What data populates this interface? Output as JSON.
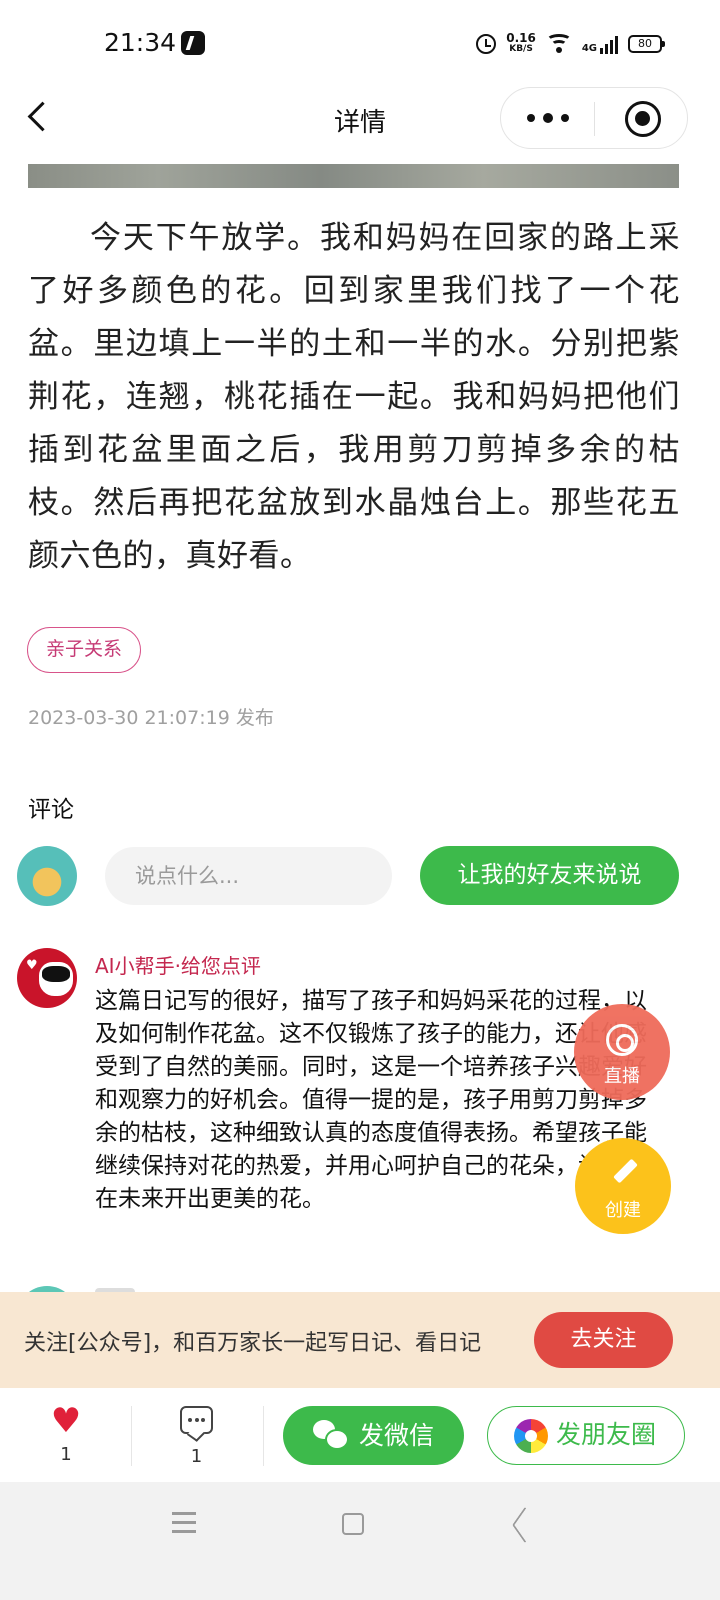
{
  "status_bar": {
    "time": "21:34",
    "net_speed": "0.16",
    "net_unit": "KB/S",
    "network": "4G",
    "battery": "80"
  },
  "nav": {
    "title": "详情"
  },
  "article": {
    "body": "今天下午放学。我和妈妈在回家的路上采了好多颜色的花。回到家里我们找了一个花盆。里边填上一半的土和一半的水。分别把紫荆花，连翘，桃花插在一起。我和妈妈把他们插到花盆里面之后，我用剪刀剪掉多余的枯枝。然后再把花盆放到水晶烛台上。那些花五颜六色的，真好看。",
    "tag": "亲子关系",
    "publish_time": "2023-03-30 21:07:19 发布"
  },
  "comments": {
    "title": "评论",
    "input_placeholder": "说点什么...",
    "friend_button": "让我的好友来说说",
    "ai_comment": {
      "author": "AI小帮手·给您点评",
      "text": "这篇日记写的很好，描写了孩子和妈妈采花的过程，以及如何制作花盆。这不仅锻炼了孩子的能力，还让他感受到了自然的美丽。同时，这是一个培养孩子兴趣爱好和观察力的好机会。值得一提的是，孩子用剪刀剪掉多余的枯枝，这种细致认真的态度值得表扬。希望孩子能继续保持对花的热爱，并用心呵护自己的花朵，让他们在未来开出更美的花。"
    }
  },
  "floating": {
    "live_label": "直播",
    "create_label": "创建"
  },
  "follow_banner": {
    "text": "关注[公众号]，和百万家长一起写日记、看日记",
    "button": "去关注"
  },
  "bottom_bar": {
    "like_count": "1",
    "comment_count": "1",
    "wechat_button": "发微信",
    "moments_button": "发朋友圈"
  },
  "colors": {
    "primary_green": "#3dba4b",
    "tag_pink": "#c63a75",
    "follow_red": "#e04a43",
    "live_orange": "#ef6b5a",
    "create_yellow": "#fcc21b"
  }
}
